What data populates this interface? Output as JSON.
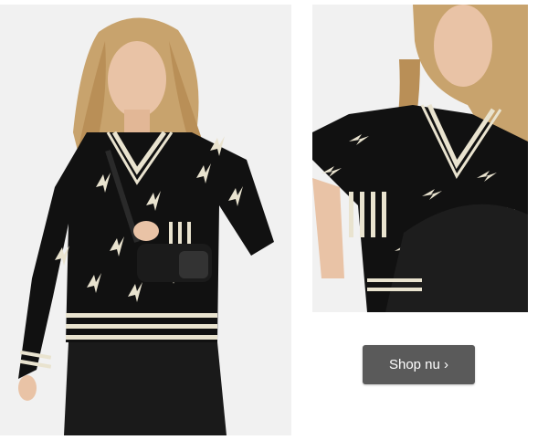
{
  "cta": {
    "label": "Shop nu ›"
  },
  "images": {
    "main": "model-wearing-black-cream-knit-sweater",
    "detail": "seated-model-sweater-closeup"
  },
  "colors": {
    "background": "#ffffff",
    "photo_background": "#f1f1f1",
    "sweater": "#111111",
    "sweater_pattern": "#e9e3cf",
    "button": "#5a5a5a",
    "button_text": "#ffffff"
  }
}
